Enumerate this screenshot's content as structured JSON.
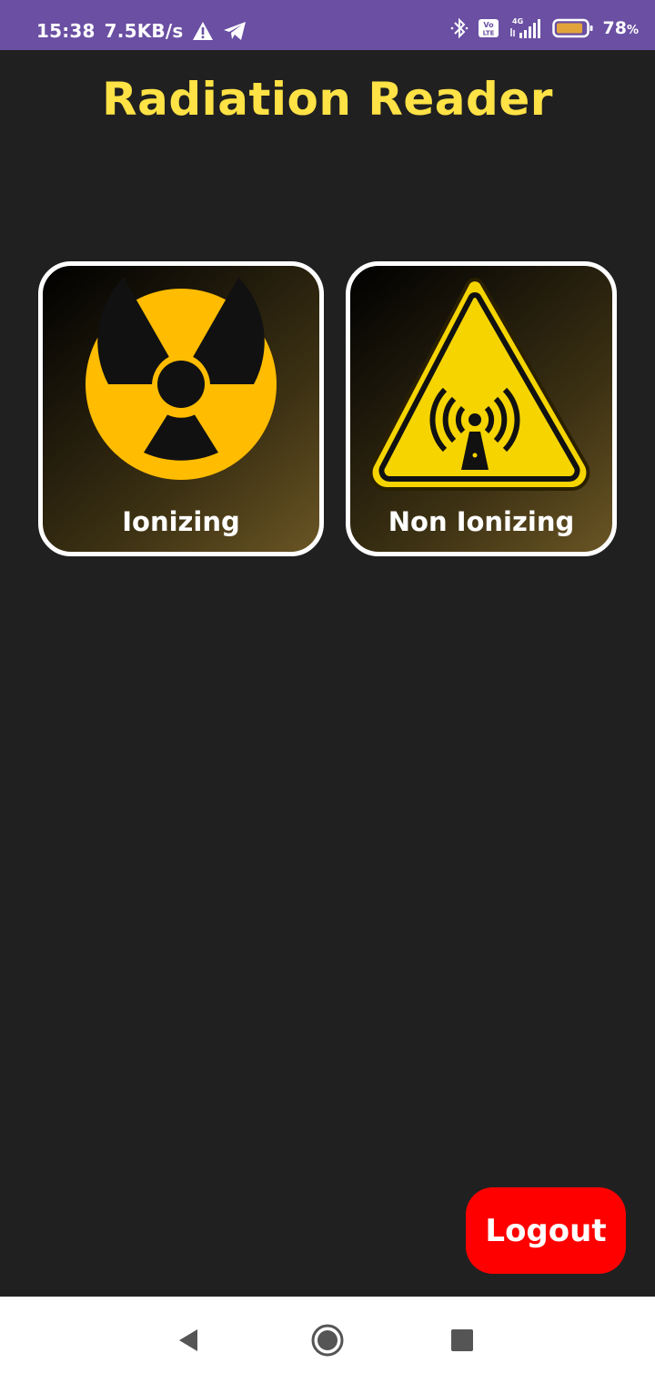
{
  "status_bar": {
    "time": "15:38",
    "net_speed": "7.5KB/s",
    "network_type": "4G",
    "volte_label": "Vo LTE",
    "battery_percent": "78",
    "battery_percent_sign": "%",
    "icons": [
      "warning-icon",
      "telegram-icon",
      "bluetooth-icon",
      "volte-icon",
      "signal-icon",
      "battery-icon"
    ]
  },
  "app": {
    "title": "Radiation Reader"
  },
  "cards": [
    {
      "label": "Ionizing",
      "icon": "radiation-trefoil-icon"
    },
    {
      "label": "Non Ionizing",
      "icon": "non-ionizing-radiation-warning-icon"
    }
  ],
  "logout": {
    "label": "Logout"
  },
  "nav_bar": {
    "icons": [
      "back-icon",
      "home-icon",
      "recents-icon"
    ]
  },
  "colors": {
    "status_bar": "#6a4fa3",
    "background": "#202020",
    "title": "#ffe245",
    "radiation_yellow": "#ffbc00",
    "warning_yellow": "#f5d400",
    "logout": "#ff0000"
  }
}
